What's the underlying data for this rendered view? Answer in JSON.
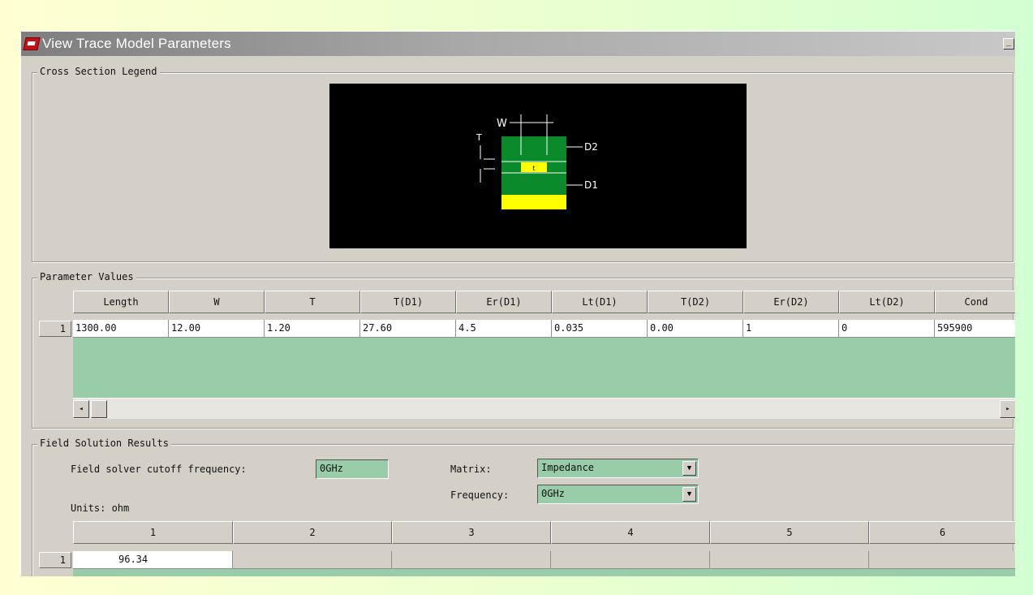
{
  "window": {
    "title": "View Trace Model Parameters",
    "minimize_label": "_"
  },
  "cross_section": {
    "group_label": "Cross Section Legend",
    "labels": {
      "w": "W",
      "t": "T",
      "d2": "D2",
      "d1": "D1",
      "trace_mark": "t"
    }
  },
  "parameters": {
    "group_label": "Parameter Values",
    "columns": [
      "Length",
      "W",
      "T",
      "T(D1)",
      "Er(D1)",
      "Lt(D1)",
      "T(D2)",
      "Er(D2)",
      "Lt(D2)",
      "Cond"
    ],
    "row_label": "1",
    "values": [
      "1300.00",
      "12.00",
      "1.20",
      "27.60",
      "4.5",
      "0.035",
      "0.00",
      "1",
      "0",
      "595900"
    ],
    "scroll_left": "◂",
    "scroll_right": "▸"
  },
  "field_solution": {
    "group_label": "Field Solution Results",
    "cutoff_label": "Field solver cutoff frequency:",
    "cutoff_value": "0GHz",
    "matrix_label": "Matrix:",
    "matrix_value": "Impedance",
    "frequency_label": "Frequency:",
    "frequency_value": "0GHz",
    "units_label": "Units: ohm",
    "columns": [
      "1",
      "2",
      "3",
      "4",
      "5",
      "6"
    ],
    "row_label": "1",
    "values": [
      "96.34",
      "",
      "",
      "",
      "",
      ""
    ]
  },
  "colors": {
    "legend_background": "#000000",
    "dielectric": "#0a8a2a",
    "conductor": "#ffff00",
    "grid_fill": "#99cca9"
  }
}
